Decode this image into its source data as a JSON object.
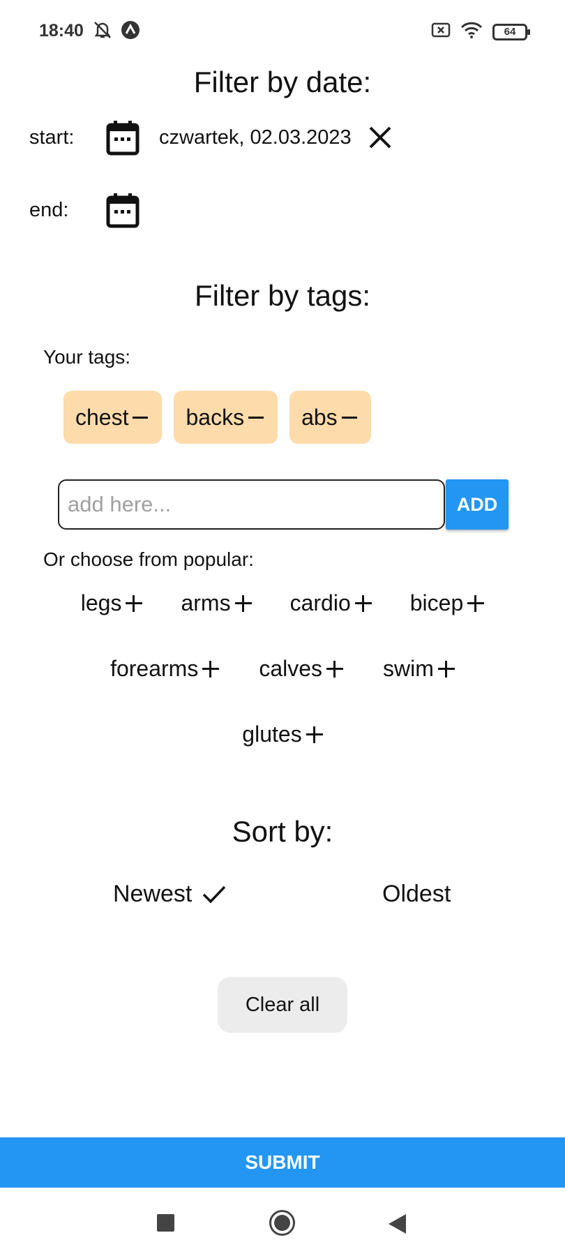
{
  "status_bar": {
    "time": "18:40",
    "battery": "64",
    "icons": [
      "mute-icon",
      "app-notification-icon",
      "no-sim-icon",
      "wifi-icon",
      "battery-icon"
    ]
  },
  "date_filter": {
    "title": "Filter by date:",
    "start_label": "start:",
    "end_label": "end:",
    "start_value": "czwartek, 02.03.2023"
  },
  "tag_filter": {
    "title": "Filter by tags:",
    "your_tags_label": "Your tags:",
    "tags": [
      {
        "label": "chest"
      },
      {
        "label": "backs"
      },
      {
        "label": "abs"
      }
    ],
    "input": {
      "placeholder": "add here...",
      "value": ""
    },
    "add_label": "ADD",
    "popular_label": "Or choose from popular:",
    "popular": [
      {
        "label": "legs"
      },
      {
        "label": "arms"
      },
      {
        "label": "cardio"
      },
      {
        "label": "bicep"
      },
      {
        "label": "forearms"
      },
      {
        "label": "calves"
      },
      {
        "label": "swim"
      },
      {
        "label": "glutes"
      }
    ]
  },
  "sort": {
    "title": "Sort by:",
    "options": [
      {
        "label": "Newest",
        "selected": true
      },
      {
        "label": "Oldest",
        "selected": false
      }
    ]
  },
  "actions": {
    "clear_all": "Clear all",
    "submit": "SUBMIT"
  },
  "colors": {
    "accent": "#2396f3",
    "tag_chip": "#fddbaa",
    "clear_button": "#ececec"
  }
}
